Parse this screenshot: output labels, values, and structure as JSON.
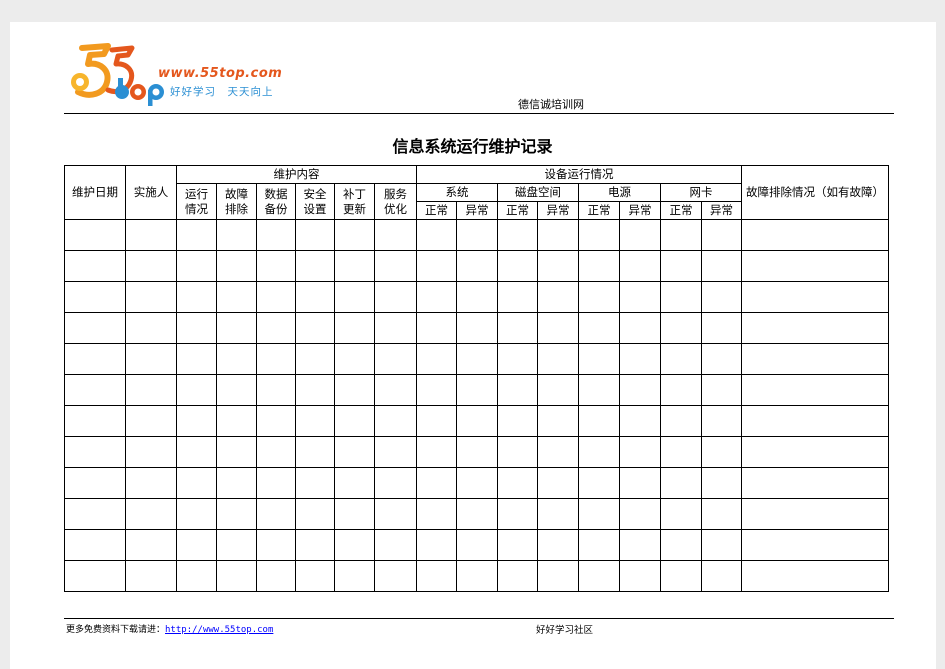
{
  "header": {
    "logo_url_text": "www.55top.com",
    "logo_slogan": "好好学习　天天向上",
    "brand": "德信诚培训网"
  },
  "document": {
    "title": "信息系统运行维护记录"
  },
  "table": {
    "col_date": "维护日期",
    "col_person": "实施人",
    "group_maintenance": "维护内容",
    "maintenance_items": [
      [
        "运行",
        "情况"
      ],
      [
        "故障",
        "排除"
      ],
      [
        "数据",
        "备份"
      ],
      [
        "安全",
        "设置"
      ],
      [
        "补丁",
        "更新"
      ],
      [
        "服务",
        "优化"
      ]
    ],
    "group_equipment": "设备运行情况",
    "equipment_items": [
      "系统",
      "磁盘空间",
      "电源",
      "网卡"
    ],
    "status_normal": "正常",
    "status_abnormal": "异常",
    "col_fault": "故障排除情况（如有故障）",
    "blank_rows": 12
  },
  "footer": {
    "more_text": "更多免费资料下载请进：",
    "link_text": "http://www.55top.com",
    "community": "好好学习社区"
  },
  "colors": {
    "logo_orange": "#e4571d",
    "logo_blue": "#2b8fd3",
    "link_blue": "#0000ff"
  }
}
